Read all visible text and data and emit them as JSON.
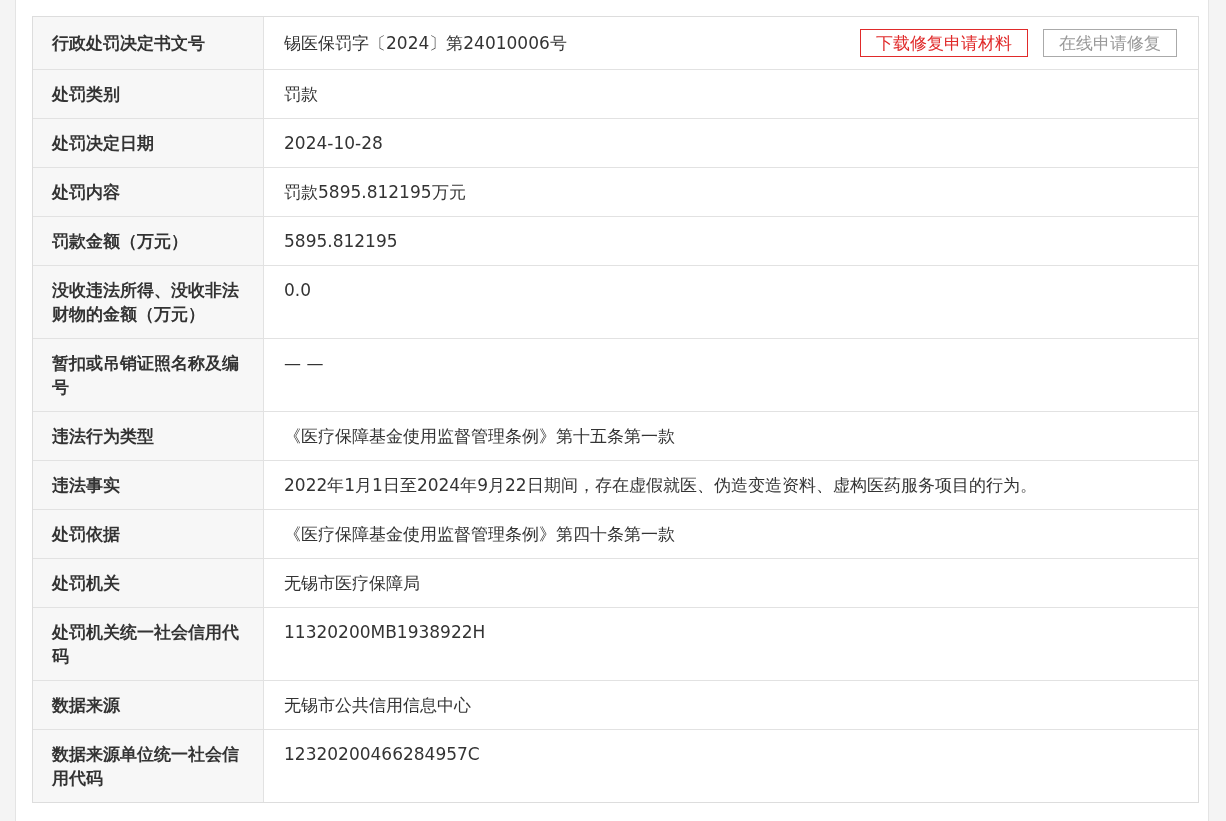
{
  "details": {
    "rows": [
      {
        "label": "行政处罚决定书文号",
        "value": "锡医保罚字〔2024〕第24010006号",
        "actions": [
          {
            "label": "下载修复申请材料",
            "disabled": false
          },
          {
            "label": "在线申请修复",
            "disabled": true
          }
        ]
      },
      {
        "label": "处罚类别",
        "value": "罚款"
      },
      {
        "label": "处罚决定日期",
        "value": "2024-10-28"
      },
      {
        "label": "处罚内容",
        "value": "罚款5895.812195万元"
      },
      {
        "label": "罚款金额（万元）",
        "value": "5895.812195"
      },
      {
        "label": "没收违法所得、没收非法财物的金额（万元）",
        "value": "0.0"
      },
      {
        "label": "暂扣或吊销证照名称及编号",
        "value": "— —"
      },
      {
        "label": "违法行为类型",
        "value": "《医疗保障基金使用监督管理条例》第十五条第一款"
      },
      {
        "label": "违法事实",
        "value": "2022年1月1日至2024年9月22日期间，存在虚假就医、伪造变造资料、虚构医药服务项目的行为。"
      },
      {
        "label": "处罚依据",
        "value": "《医疗保障基金使用监督管理条例》第四十条第一款"
      },
      {
        "label": "处罚机关",
        "value": "无锡市医疗保障局"
      },
      {
        "label": "处罚机关统一社会信用代码",
        "value": "11320200MB1938922H"
      },
      {
        "label": "数据来源",
        "value": "无锡市公共信用信息中心"
      },
      {
        "label": "数据来源单位统一社会信用代码",
        "value": "12320200466284957C"
      }
    ]
  }
}
